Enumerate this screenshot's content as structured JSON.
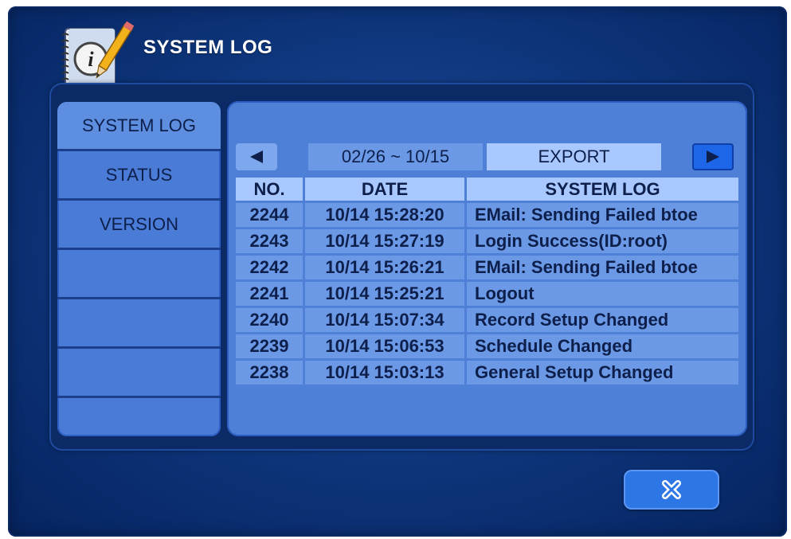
{
  "window": {
    "title": "SYSTEM LOG"
  },
  "sidebar": {
    "items": [
      {
        "label": "SYSTEM LOG",
        "active": true
      },
      {
        "label": "STATUS"
      },
      {
        "label": "VERSION"
      },
      {
        "label": ""
      },
      {
        "label": ""
      },
      {
        "label": ""
      },
      {
        "label": ""
      }
    ]
  },
  "toolbar": {
    "prev_icon": "triangle-left-icon",
    "date_range": "02/26 ~ 10/15",
    "export_label": "EXPORT",
    "next_icon": "triangle-right-icon"
  },
  "table": {
    "columns": [
      "NO.",
      "DATE",
      "SYSTEM LOG"
    ],
    "rows": [
      {
        "no": "2244",
        "date": "10/14 15:28:20",
        "log": "EMail: Sending Failed btoe"
      },
      {
        "no": "2243",
        "date": "10/14 15:27:19",
        "log": "Login Success(ID:root)"
      },
      {
        "no": "2242",
        "date": "10/14 15:26:21",
        "log": "EMail: Sending Failed btoe"
      },
      {
        "no": "2241",
        "date": "10/14 15:25:21",
        "log": "Logout"
      },
      {
        "no": "2240",
        "date": "10/14 15:07:34",
        "log": "Record Setup Changed"
      },
      {
        "no": "2239",
        "date": "10/14 15:06:53",
        "log": "Schedule Changed"
      },
      {
        "no": "2238",
        "date": "10/14 15:03:13",
        "log": "General Setup Changed"
      }
    ]
  },
  "footer": {
    "close_icon": "close-x-icon"
  },
  "colors": {
    "background": "#0d3479",
    "panel": "#4e80d8",
    "cell": "#6b99e6",
    "header_cell": "#a9c8ff",
    "button_active": "#1e66e8"
  }
}
